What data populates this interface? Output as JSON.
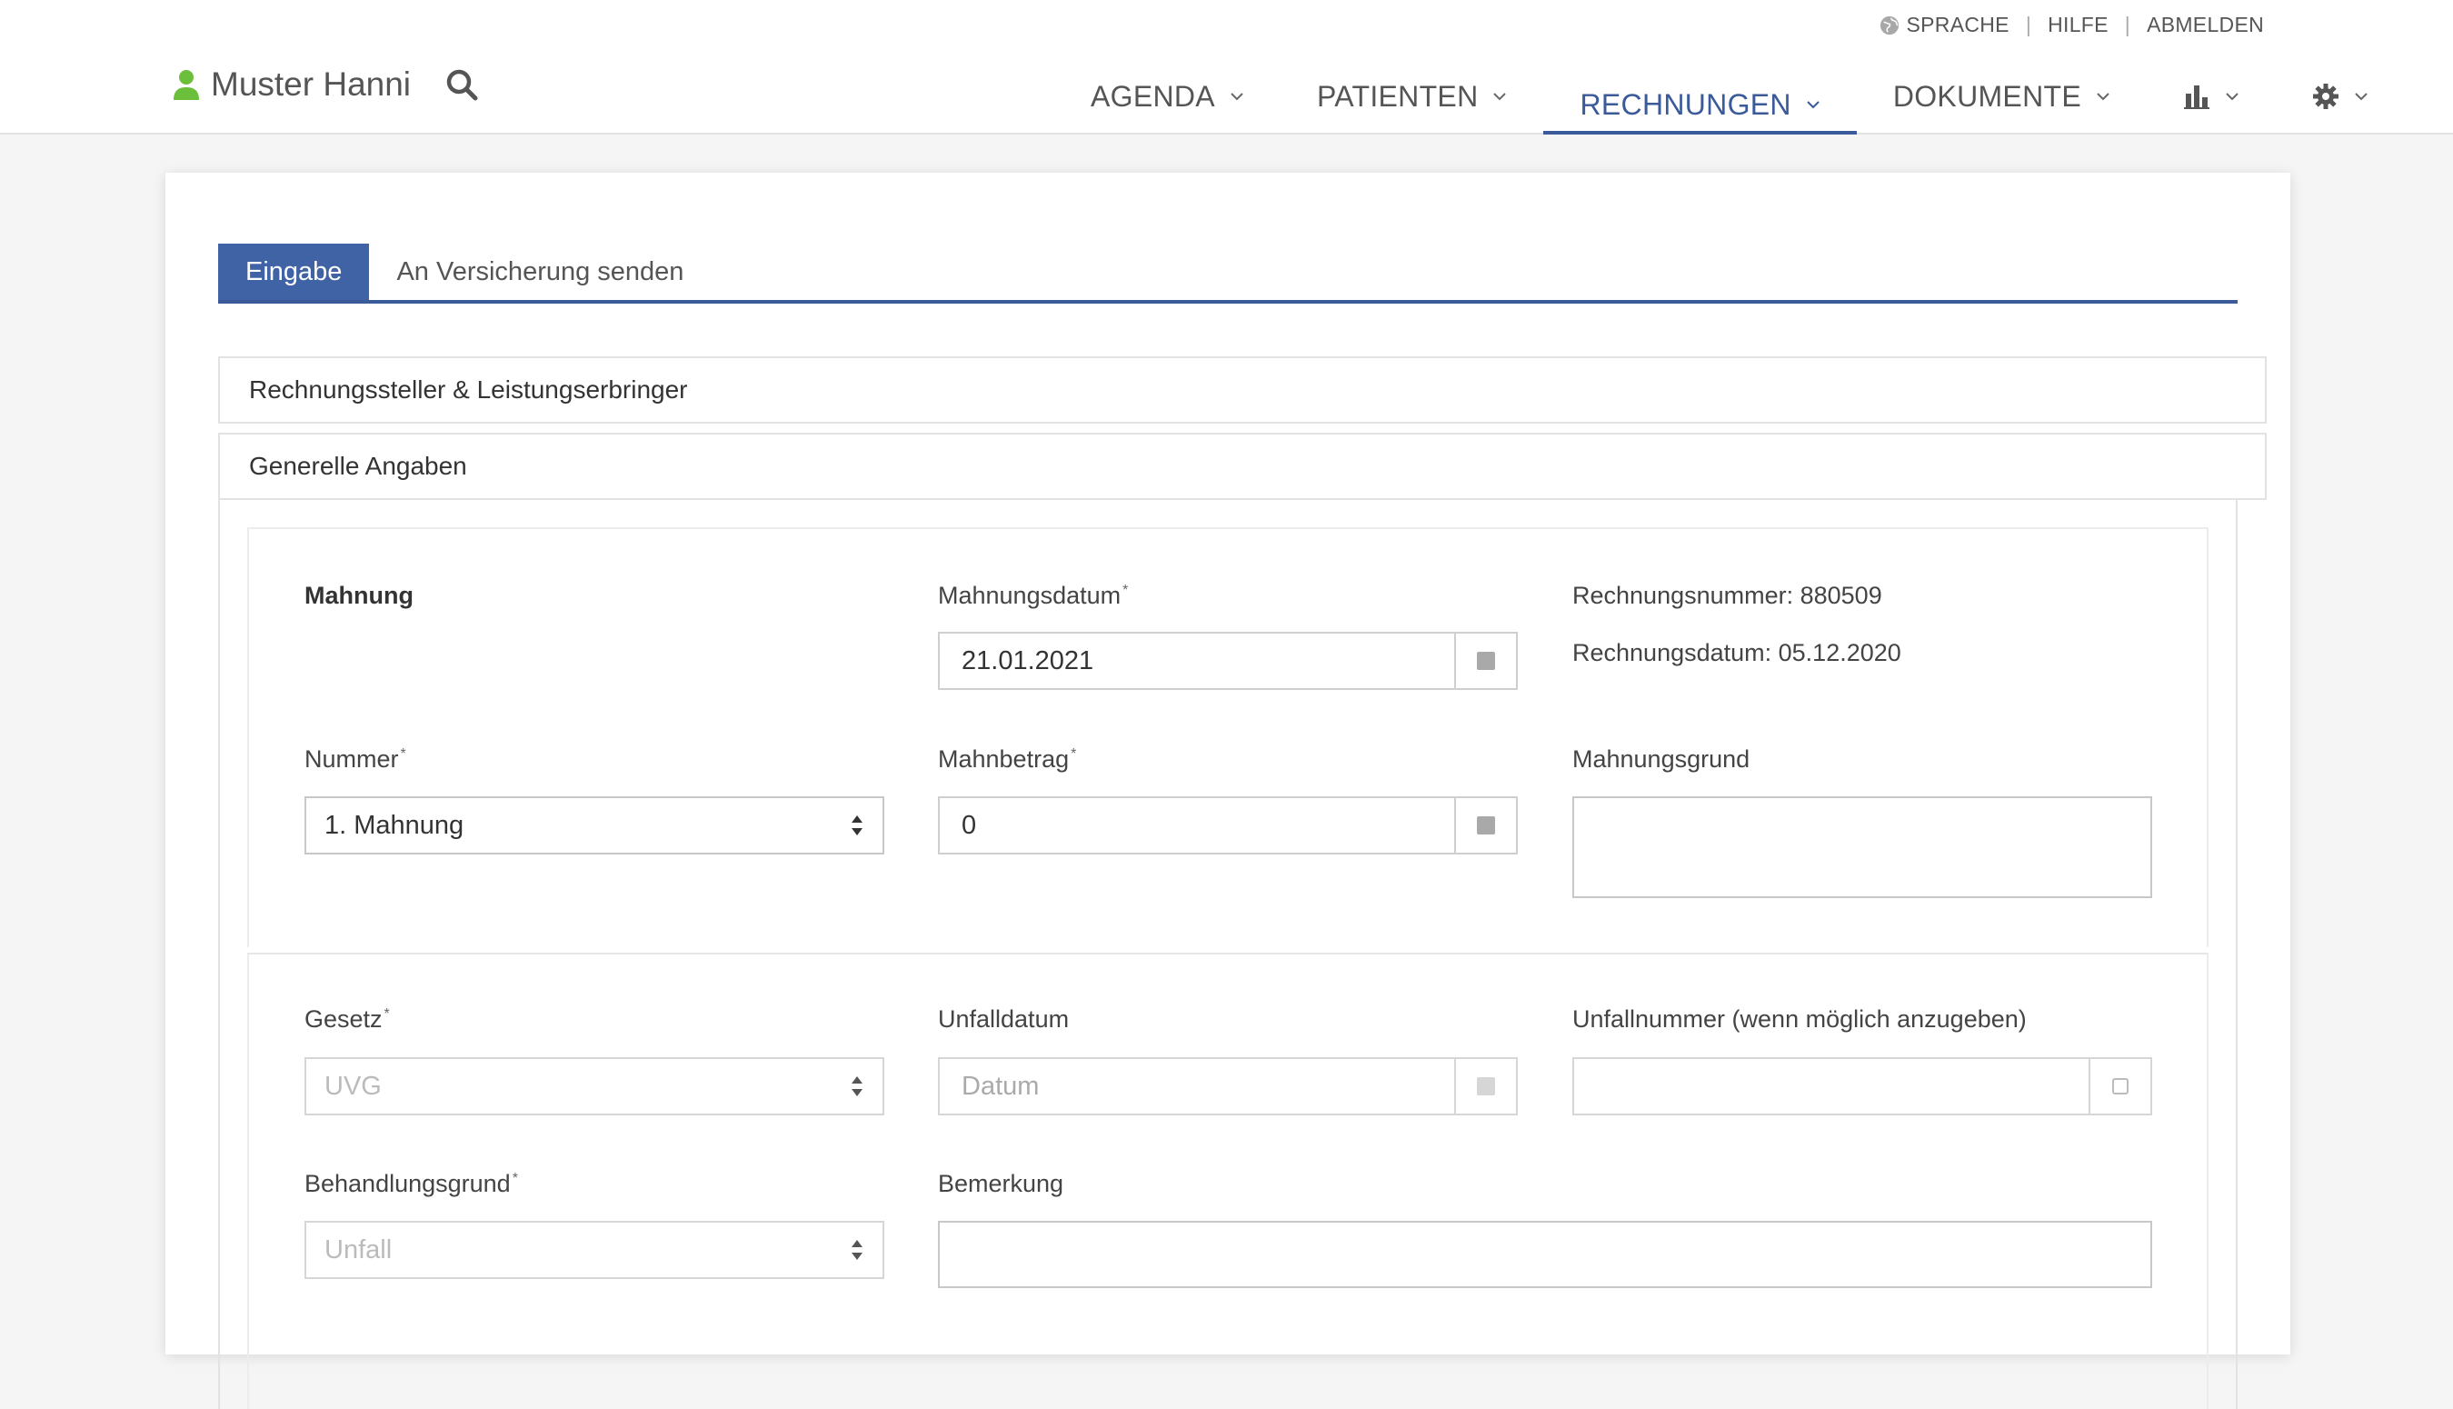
{
  "header": {
    "utility": {
      "language": "SPRACHE",
      "help": "HILFE",
      "logout": "ABMELDEN",
      "separator": "|"
    },
    "user": {
      "name": "Muster Hanni",
      "icon": "user-icon"
    },
    "nav": [
      {
        "label": "AGENDA",
        "active": false
      },
      {
        "label": "PATIENTEN",
        "active": false
      },
      {
        "label": "RECHNUNGEN",
        "active": true
      },
      {
        "label": "DOKUMENTE",
        "active": false
      }
    ],
    "nav_icons": {
      "stats": "bar-chart-icon",
      "settings": "gear-icon"
    },
    "colors": {
      "accent": "#3b5a9a",
      "user_icon": "#6cbf3a"
    }
  },
  "tabs": [
    {
      "label": "Eingabe",
      "active": true
    },
    {
      "label": "An Versicherung senden",
      "active": false
    }
  ],
  "panels": {
    "issuer": "Rechnungssteller & Leistungserbringer",
    "general": "Generelle Angaben"
  },
  "reminder": {
    "section_label": "Mahnung",
    "date_label": "Mahnungsdatum",
    "date_value": "21.01.2021",
    "invoice_number": "Rechnungsnummer: 880509",
    "invoice_date": "Rechnungsdatum: 05.12.2020",
    "number_label": "Nummer",
    "number_value": "1. Mahnung",
    "amount_label": "Mahnbetrag",
    "amount_value": "0",
    "reason_label": "Mahnungsgrund",
    "required_mark": "*"
  },
  "case": {
    "law_label": "Gesetz",
    "law_value": "UVG",
    "accident_date_label": "Unfalldatum",
    "accident_date_placeholder": "Datum",
    "accident_number_label": "Unfallnummer (wenn möglich anzugeben)",
    "treatment_label": "Behandlungsgrund",
    "treatment_value": "Unfall",
    "remark_label": "Bemerkung"
  }
}
